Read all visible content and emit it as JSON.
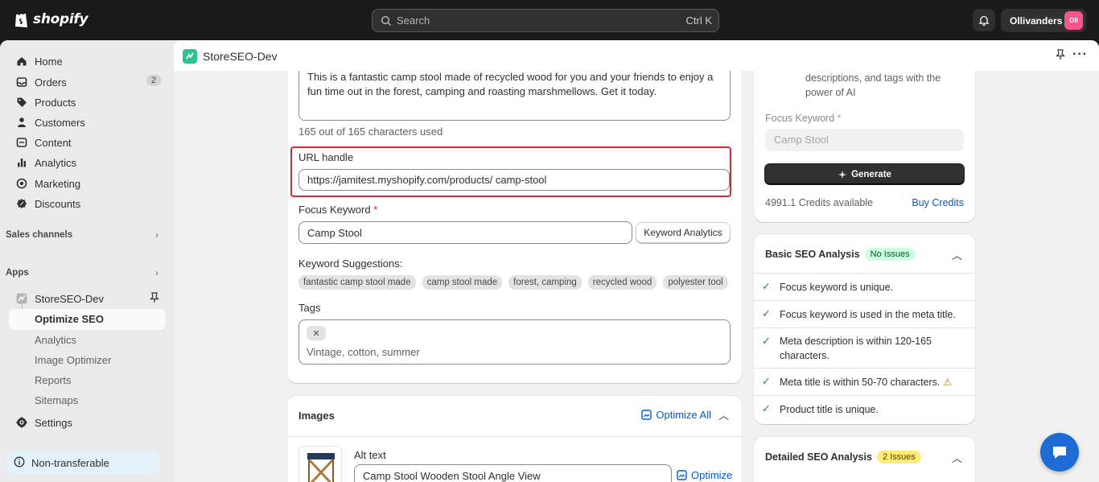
{
  "topbar": {
    "brand": "shopify",
    "search_placeholder": "Search",
    "search_shortcut": "Ctrl K",
    "store_name": "Ollivanders",
    "store_initials": "Oll"
  },
  "sidebar": {
    "items": [
      {
        "label": "Home",
        "icon": "home-icon"
      },
      {
        "label": "Orders",
        "icon": "orders-icon",
        "badge": "2"
      },
      {
        "label": "Products",
        "icon": "tag-icon"
      },
      {
        "label": "Customers",
        "icon": "person-icon"
      },
      {
        "label": "Content",
        "icon": "content-icon"
      },
      {
        "label": "Analytics",
        "icon": "bar-chart-icon"
      },
      {
        "label": "Marketing",
        "icon": "target-icon"
      },
      {
        "label": "Discounts",
        "icon": "discount-icon"
      }
    ],
    "sales_channels": "Sales channels",
    "apps": "Apps",
    "app_name": "StoreSEO-Dev",
    "sub_items": [
      "Optimize SEO",
      "Analytics",
      "Image Optimizer",
      "Reports",
      "Sitemaps"
    ],
    "settings": "Settings",
    "non_transferable": "Non-transferable"
  },
  "appbar": {
    "title": "StoreSEO-Dev"
  },
  "editor": {
    "meta_description": "This is a fantastic camp stool made of recycled wood for you and your friends to enjoy a fun time out in the forest, camping and roasting marshmellows. Get it today.",
    "char_count": "165 out of 165 characters used",
    "url_label": "URL handle",
    "url_value": "https://jamitest.myshopify.com/products/  camp-stool",
    "focus_label": "Focus Keyword",
    "focus_required": "*",
    "focus_value": "Camp Stool",
    "keyword_analytics_btn": "Keyword Analytics",
    "suggestions_label": "Keyword Suggestions:",
    "suggestions": [
      "fantastic camp stool made",
      "camp stool made",
      "forest, camping",
      "recycled wood",
      "polyester tool"
    ],
    "tags_label": "Tags",
    "tags_placeholder": "Vintage, cotton, summer"
  },
  "images": {
    "title": "Images",
    "optimize_all": "Optimize All",
    "alt_label": "Alt text",
    "alt_value": "Camp Stool Wooden Stool Angle View",
    "optimize": "Optimize"
  },
  "ai_panel": {
    "desc": "descriptions, and tags with the power of AI",
    "focus_label": "Focus Keyword",
    "focus_required": "*",
    "focus_placeholder": "Camp Stool",
    "generate": "Generate",
    "credits": "4991.1 Credits available",
    "buy": "Buy Credits"
  },
  "basic_seo": {
    "title": "Basic SEO Analysis",
    "badge": "No Issues",
    "checks": [
      "Focus keyword is unique.",
      "Focus keyword is used in the meta title.",
      "Meta description is within 120-165 characters.",
      "Meta title is within 50-70 characters.",
      "Product title is unique."
    ]
  },
  "detailed_seo": {
    "title": "Detailed SEO Analysis",
    "badge": "2 Issues"
  },
  "colors": {
    "topbar": "#1a1a1a",
    "highlight": "#d22a35",
    "link": "#005bd3",
    "success": "#29845a",
    "app_icon": "#2bc48a",
    "chat": "#1e6bd6"
  }
}
